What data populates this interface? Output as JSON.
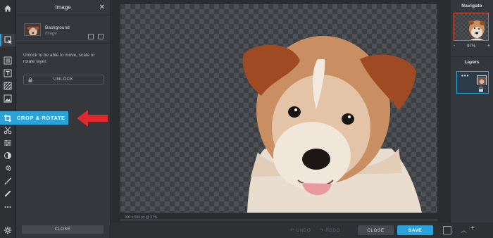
{
  "toolbar": {
    "tools": [
      {
        "icon": "home-icon"
      },
      {
        "icon": "arrange-icon"
      },
      {
        "icon": "layers-list-icon"
      },
      {
        "icon": "text-icon"
      },
      {
        "icon": "texture-icon"
      },
      {
        "icon": "image-icon"
      },
      {
        "icon": "crop-icon"
      },
      {
        "icon": "scissors-icon"
      },
      {
        "icon": "adjust-sliders-icon"
      },
      {
        "icon": "filter-icon"
      },
      {
        "icon": "swirl-icon"
      },
      {
        "icon": "brush-icon"
      },
      {
        "icon": "eyedropper-icon"
      },
      {
        "icon": "more-icon"
      },
      {
        "icon": "settings-icon"
      }
    ]
  },
  "panel": {
    "title": "Image",
    "layer_name": "Background",
    "layer_type": "Image",
    "unlock_text": "Unlock to be able to move, scale or rotate layer.",
    "unlock_label": "UNLOCK",
    "close_label": "CLOSE"
  },
  "crop": {
    "label": "CROP & ROTATE",
    "arrow_color": "#e0282e"
  },
  "canvas": {
    "info": "900 x 599 px @ 97%"
  },
  "bottom": {
    "undo_label": "UNDO",
    "redo_label": "REDO",
    "close_label": "CLOSE",
    "save_label": "SAVE"
  },
  "right_panel": {
    "navigate_title": "Navigate",
    "zoom_minus": "-",
    "zoom_value": "97%",
    "zoom_plus": "+",
    "layers_title": "Layers"
  },
  "colors": {
    "accent": "#29a3d9",
    "arrow": "#e0282e",
    "nav_border": "#e05a3e"
  }
}
